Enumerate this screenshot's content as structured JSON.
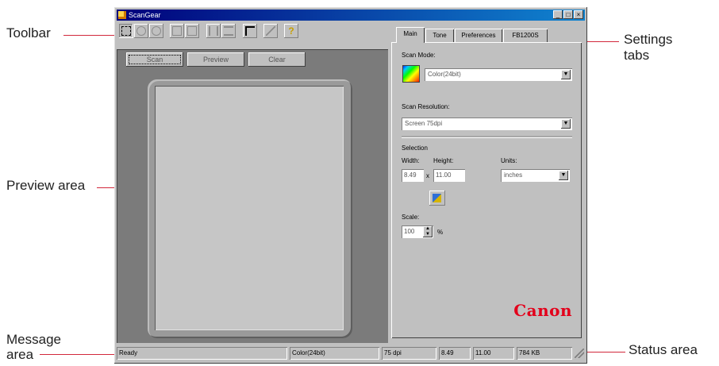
{
  "callouts": {
    "toolbar": "Toolbar",
    "preview_area": "Preview area",
    "message_area": "Message\narea",
    "settings_tabs": "Settings\ntabs",
    "status_area": "Status area"
  },
  "window": {
    "title": "ScanGear",
    "minimize": "_",
    "maximize": "□",
    "close": "×"
  },
  "toolbar": {
    "buttons": [
      "select-area",
      "zoom-in",
      "zoom-out",
      "rotate-left",
      "rotate-right",
      "flip-horizontal",
      "flip-vertical",
      "crop",
      "options",
      "help"
    ]
  },
  "preview_buttons": {
    "scan": "Scan",
    "preview": "Preview",
    "clear": "Clear"
  },
  "tabs": [
    "Main",
    "Tone",
    "Preferences",
    "FB1200S"
  ],
  "main_tab": {
    "scan_mode_label": "Scan Mode:",
    "scan_mode_value": "Color(24bit)",
    "scan_resolution_label": "Scan Resolution:",
    "scan_resolution_value": "Screen 75dpi",
    "selection_label": "Selection",
    "width_label": "Width:",
    "height_label": "Height:",
    "units_label": "Units:",
    "width_value": "8.49",
    "times": "x",
    "height_value": "11.00",
    "units_value": "inches",
    "scale_label": "Scale:",
    "scale_value": "100",
    "percent": "%",
    "brand": "Canon"
  },
  "status": {
    "message": "Ready",
    "mode": "Color(24bit)",
    "resolution": "75 dpi",
    "width": "8.49",
    "height": "11.00",
    "size": "784 KB"
  },
  "colors": {
    "title_bar": "#00007b",
    "brand_red": "#e3001b",
    "callout_line": "#d2283c"
  }
}
